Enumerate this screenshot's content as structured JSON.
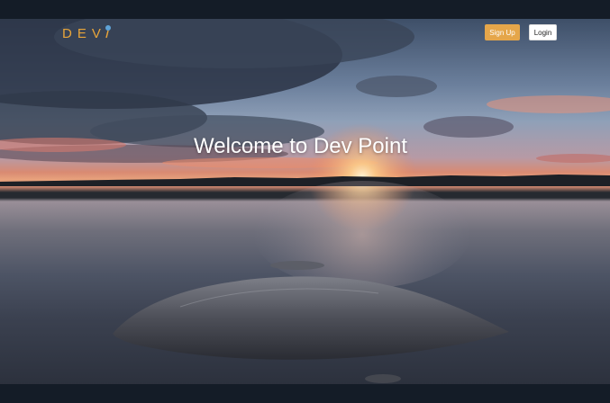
{
  "brand": {
    "name": "DEV",
    "icon": "pin-icon",
    "color": "#e8a53a"
  },
  "nav": {
    "signup_label": "Sign Up",
    "login_label": "Login"
  },
  "hero": {
    "title": "Welcome to Dev Point"
  },
  "colors": {
    "accent": "#e5a64a",
    "background": "#121a24"
  }
}
